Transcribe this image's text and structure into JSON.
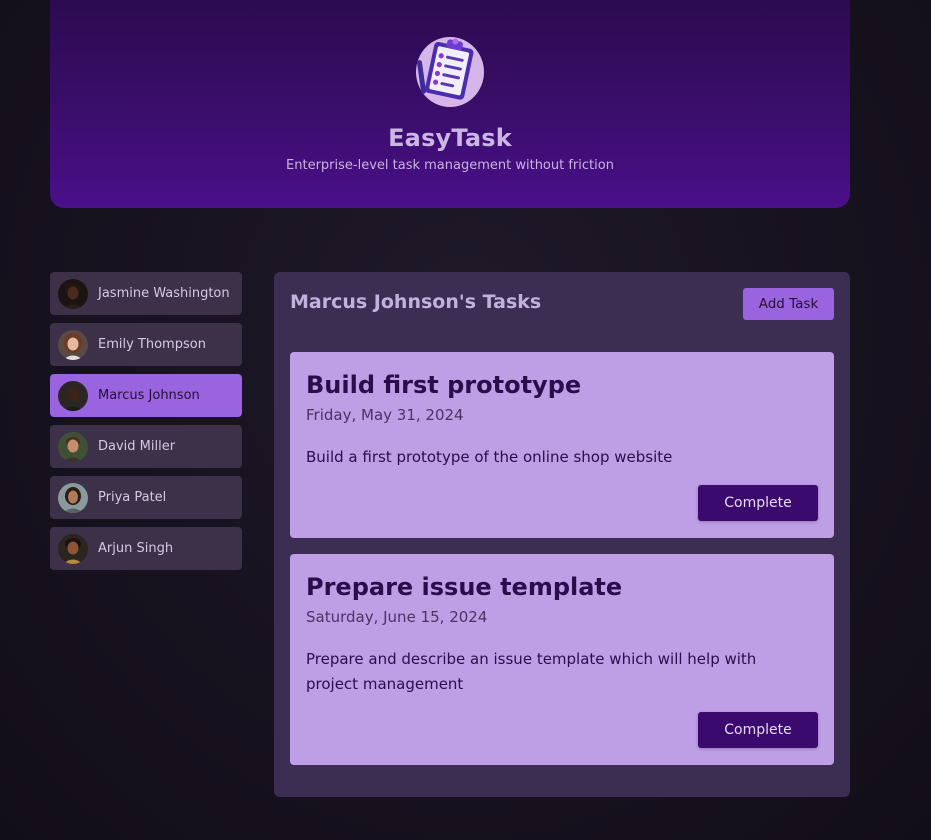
{
  "header": {
    "logo_icon": "clipboard-checklist-icon",
    "title": "EasyTask",
    "subtitle": "Enterprise-level task management without friction"
  },
  "users": [
    {
      "name": "Jasmine Washington",
      "selected": false
    },
    {
      "name": "Emily Thompson",
      "selected": false
    },
    {
      "name": "Marcus Johnson",
      "selected": true
    },
    {
      "name": "David Miller",
      "selected": false
    },
    {
      "name": "Priya Patel",
      "selected": false
    },
    {
      "name": "Arjun Singh",
      "selected": false
    }
  ],
  "tasks_panel": {
    "title": "Marcus Johnson's Tasks",
    "add_button_label": "Add Task",
    "tasks": [
      {
        "title": "Build first prototype",
        "date": "Friday, May 31, 2024",
        "description": "Build a first prototype of the online shop website",
        "complete_label": "Complete"
      },
      {
        "title": "Prepare issue template",
        "date": "Saturday, June 15, 2024",
        "description": "Prepare and describe an issue template which will help with project management",
        "complete_label": "Complete"
      }
    ]
  },
  "colors": {
    "page_background": "#17121f",
    "header_gradient_top": "#2c0b4f",
    "header_gradient_bottom": "#4a0f8a",
    "accent": "#9a64e0",
    "panel_background": "#3c2d52",
    "card_background": "#be9fe6",
    "complete_button": "#3a0a6e",
    "user_item_background": "#3c3148"
  }
}
